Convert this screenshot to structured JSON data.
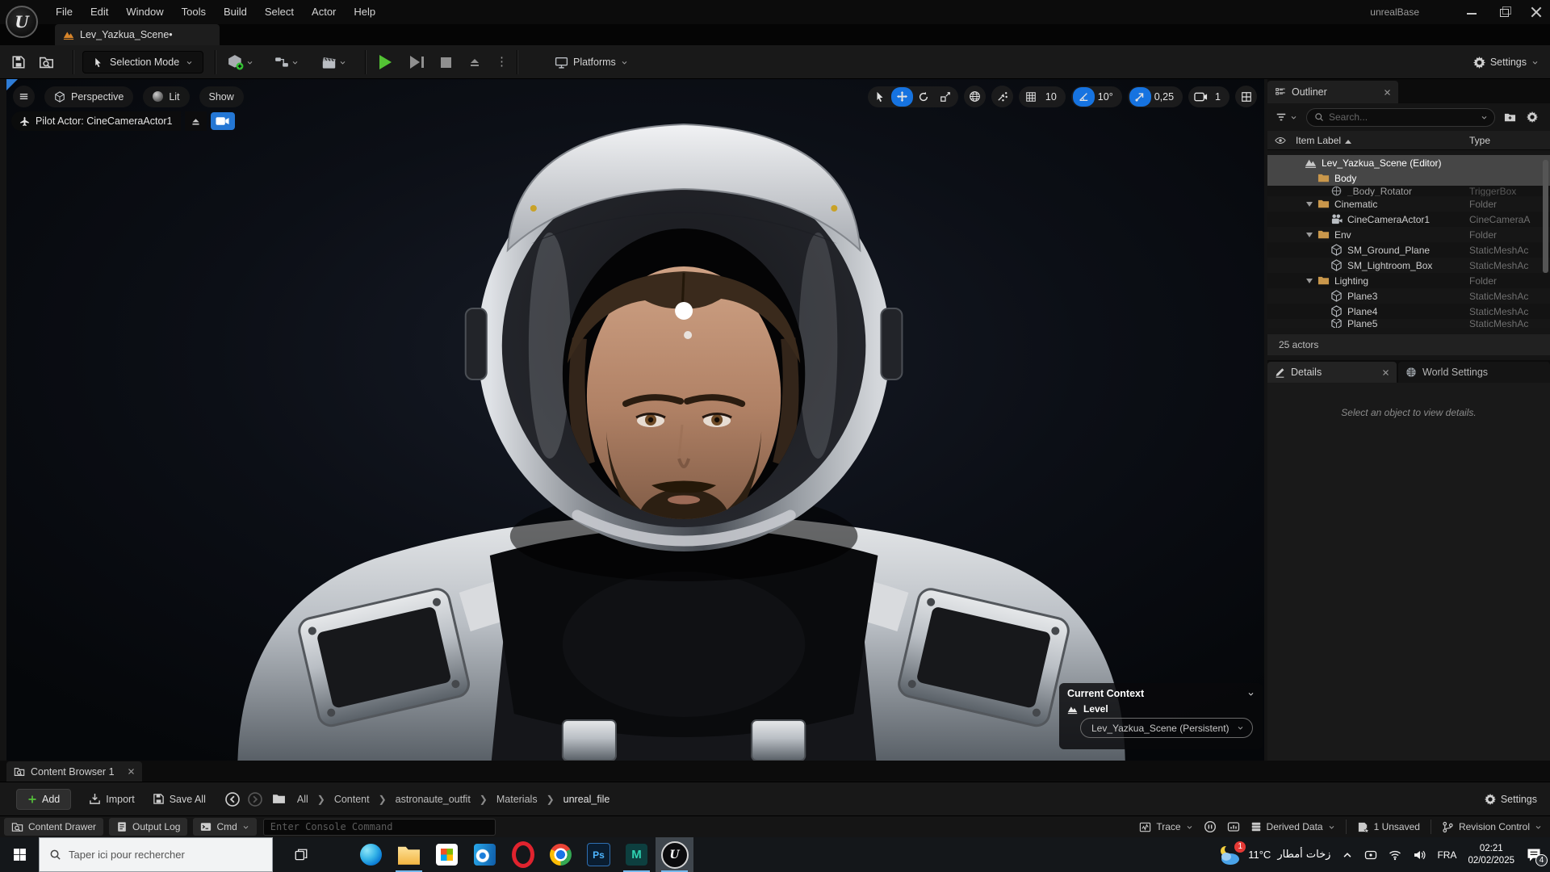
{
  "colors": {
    "accent_blue": "#1673e0",
    "play_green": "#53c234",
    "folder_tan": "#c9974b",
    "selection_gray": "#464646"
  },
  "titlebar": {
    "menus": [
      "File",
      "Edit",
      "Window",
      "Tools",
      "Build",
      "Select",
      "Actor",
      "Help"
    ],
    "window_title": "unrealBase",
    "logo_glyph": "U"
  },
  "level_tab": "Lev_Yazkua_Scene•",
  "toolbar": {
    "selection_mode": "Selection Mode",
    "platforms_label": "Platforms",
    "settings_label": "Settings"
  },
  "viewport": {
    "menu_pills": {
      "perspective": "Perspective",
      "lit": "Lit",
      "show": "Show"
    },
    "pilot_label": "Pilot Actor: CineCameraActor1",
    "snaps": {
      "grid": "10",
      "rotation": "10°",
      "scale": "0,25",
      "camera_speed": "1"
    }
  },
  "current_context": {
    "title": "Current Context",
    "level_label": "Level",
    "level_value": "Lev_Yazkua_Scene (Persistent)"
  },
  "outliner": {
    "tab": "Outliner",
    "search_placeholder": "Search...",
    "col_item": "Item Label",
    "col_type": "Type",
    "rows": [
      {
        "label": "Lev_Yazkua_Scene (Editor)",
        "type": "",
        "icon": "level",
        "indent": 1,
        "selected": true
      },
      {
        "label": "Body",
        "type": "",
        "icon": "folder",
        "indent": 2,
        "selected": true
      },
      {
        "label": "_Body_Rotator",
        "type": "TriggerBox",
        "icon": "trigger",
        "indent": 3,
        "cls": "clip-top"
      },
      {
        "label": "Cinematic",
        "type": "Folder",
        "icon": "folder",
        "indent": 2,
        "arrow": true
      },
      {
        "label": "CineCameraActor1",
        "type": "CineCameraA",
        "icon": "camera",
        "indent": 3
      },
      {
        "label": "Env",
        "type": "Folder",
        "icon": "folder",
        "indent": 2,
        "arrow": true
      },
      {
        "label": "SM_Ground_Plane",
        "type": "StaticMeshAc",
        "icon": "mesh",
        "indent": 3
      },
      {
        "label": "SM_Lightroom_Box",
        "type": "StaticMeshAc",
        "icon": "mesh",
        "indent": 3
      },
      {
        "label": "Lighting",
        "type": "Folder",
        "icon": "folder",
        "indent": 2,
        "arrow": true
      },
      {
        "label": "Plane3",
        "type": "StaticMeshAc",
        "icon": "mesh",
        "indent": 3
      },
      {
        "label": "Plane4",
        "type": "StaticMeshAc",
        "icon": "mesh",
        "indent": 3
      },
      {
        "label": "Plane5",
        "type": "StaticMeshAc",
        "icon": "mesh",
        "indent": 3,
        "cls": "clip-bottom"
      }
    ],
    "footer": "25 actors"
  },
  "details": {
    "tab": "Details",
    "world_settings_tab": "World Settings",
    "empty_message": "Select an object to view details."
  },
  "content_browser": {
    "tab": "Content Browser 1",
    "add_label": "Add",
    "import_label": "Import",
    "save_all_label": "Save All",
    "breadcrumbs": [
      "All",
      "Content",
      "astronaute_outfit",
      "Materials",
      "unreal_file"
    ],
    "settings_label": "Settings"
  },
  "status_bar": {
    "content_drawer": "Content Drawer",
    "output_log": "Output Log",
    "cmd": "Cmd",
    "console_placeholder": "Enter Console Command",
    "trace": "Trace",
    "derived_data": "Derived Data",
    "unsaved": "1 Unsaved",
    "revision_control": "Revision Control"
  },
  "taskbar": {
    "search_placeholder": "Taper ici pour rechercher",
    "apps": [
      {
        "name": "edge"
      },
      {
        "name": "explorer",
        "underline": true
      },
      {
        "name": "store"
      },
      {
        "name": "outlook"
      },
      {
        "name": "opera"
      },
      {
        "name": "chrome"
      },
      {
        "name": "photoshop",
        "glyph": "Ps"
      },
      {
        "name": "maya",
        "glyph": "M",
        "underline": true
      },
      {
        "name": "unreal",
        "glyph": "U",
        "active": true,
        "underline": true
      }
    ],
    "weather_badge": "1",
    "weather_temp": "11°C",
    "weather_desc": "زخات أمطار",
    "language": "FRA",
    "time": "02:21",
    "date": "02/02/2025",
    "notification_count": "4"
  }
}
